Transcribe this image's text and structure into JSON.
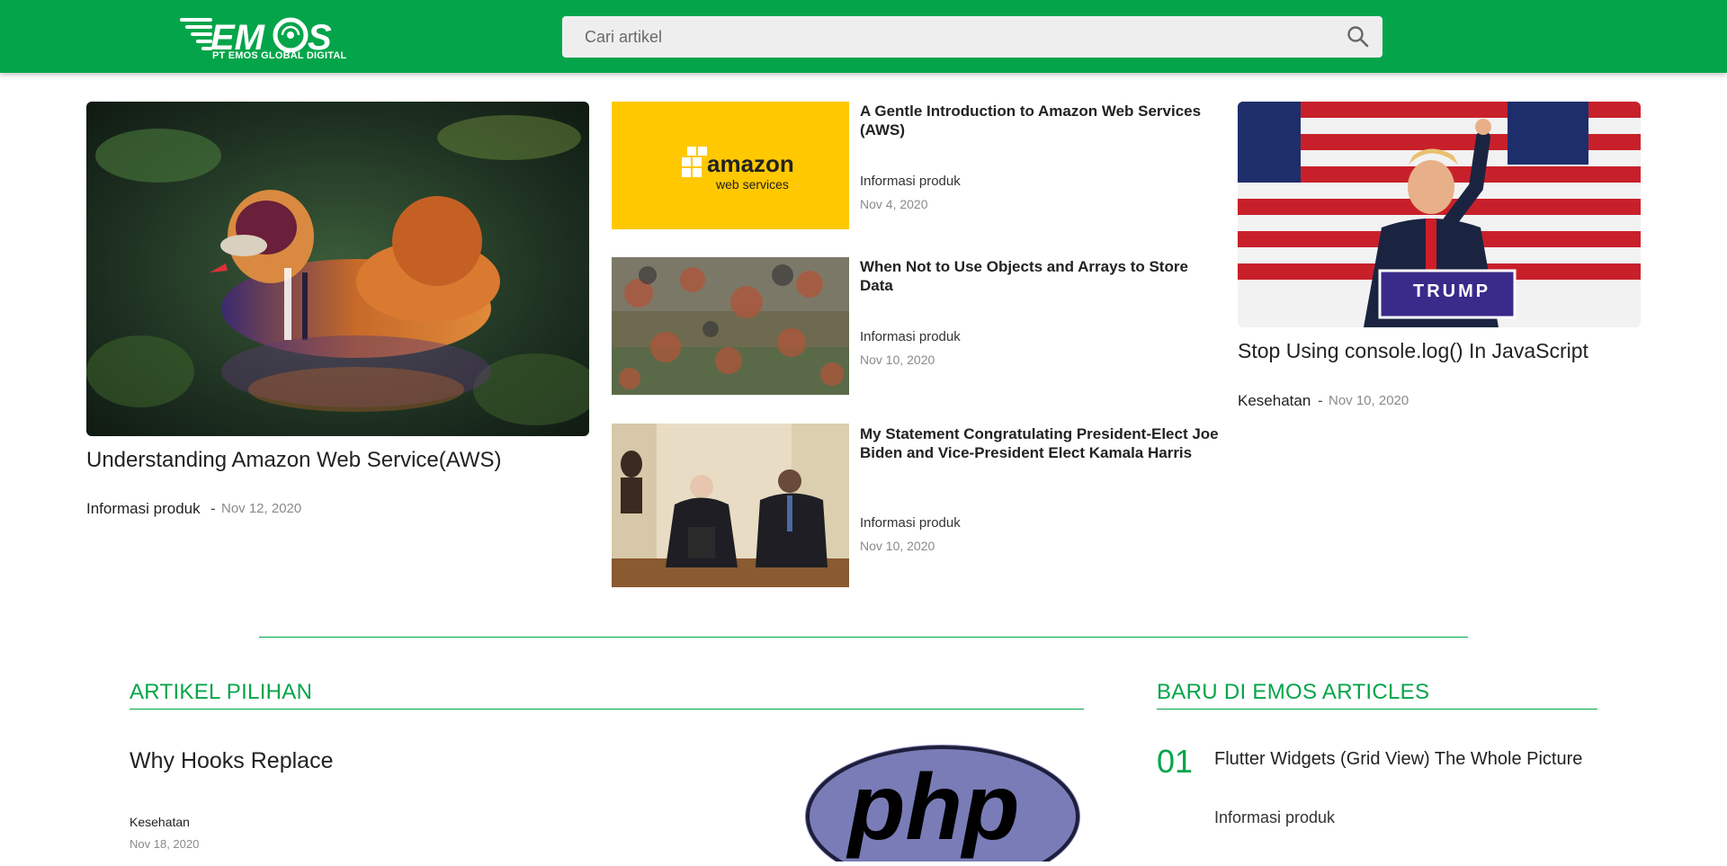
{
  "header": {
    "logo_text": "EMOS",
    "logo_subtitle": "PT EMOS GLOBAL DIGITAL",
    "search_placeholder": "Cari artikel"
  },
  "hero": {
    "title": "Understanding Amazon Web Service(AWS)",
    "category": "Informasi produk",
    "separator": "-",
    "date": "Nov 12, 2020"
  },
  "middle_articles": [
    {
      "title": "A Gentle Introduction to Amazon Web Services (AWS)",
      "category": "Informasi produk",
      "date": "Nov 4, 2020",
      "thumb_text_1": "amazon",
      "thumb_text_2": "web services"
    },
    {
      "title": "When Not to Use Objects and Arrays to Store Data",
      "category": "Informasi produk",
      "date": "Nov 10, 2020"
    },
    {
      "title": "My Statement Congratulating President-Elect Joe Biden and Vice-President Elect Kamala Harris",
      "category": "Informasi produk",
      "date": "Nov 10, 2020"
    }
  ],
  "right_article": {
    "title": "Stop Using console.log() In JavaScript",
    "category": "Kesehatan",
    "separator": "-",
    "date": "Nov 10, 2020",
    "podium_text": "TRUMP"
  },
  "featured": {
    "section_title": "ARTIKEL PILIHAN",
    "title": "Why Hooks Replace",
    "category": "Kesehatan",
    "date": "Nov 18, 2020",
    "thumb_text": "php"
  },
  "new_articles": {
    "section_title": "BARU DI EMOS ARTICLES",
    "items": [
      {
        "number": "01",
        "title": "Flutter Widgets (Grid View) The Whole Picture",
        "category": "Informasi produk"
      }
    ]
  },
  "colors": {
    "brand_green": "#04a54a",
    "amazon_yellow": "#ffc800"
  }
}
